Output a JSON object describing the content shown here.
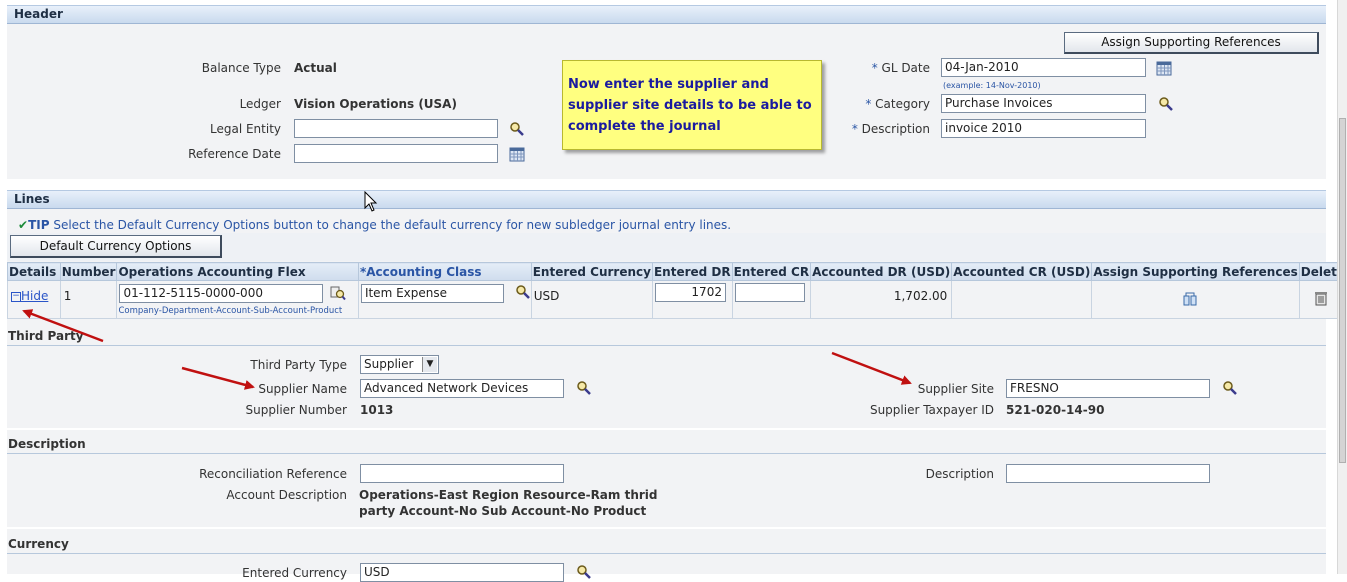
{
  "header": {
    "section_title": "Header",
    "assign_btn": "Assign Supporting References",
    "balance_type_label": "Balance Type",
    "balance_type_value": "Actual",
    "ledger_label": "Ledger",
    "ledger_value": "Vision Operations (USA)",
    "legal_entity_label": "Legal Entity",
    "legal_entity_value": "",
    "reference_date_label": "Reference Date",
    "reference_date_value": "",
    "gl_date_label": "GL Date",
    "gl_date_value": "04-Jan-2010",
    "gl_date_hint": "(example: 14-Nov-2010)",
    "category_label": "Category",
    "category_value": "Purchase Invoices",
    "description_label": "Description",
    "description_value": "invoice 2010",
    "required_mark": "*"
  },
  "callout": {
    "text": "Now enter the supplier and supplier site details to be able to complete the journal"
  },
  "lines": {
    "section_title": "Lines",
    "tip_label": "TIP",
    "tip_text": "Select the Default Currency Options button to change the default currency for new subledger journal entry lines.",
    "default_currency_btn": "Default Currency Options",
    "columns": [
      "Details",
      "Number",
      "Operations Accounting Flex",
      "*Accounting Class",
      "Entered Currency",
      "Entered DR",
      "Entered CR",
      "Accounted DR (USD)",
      "Accounted CR (USD)",
      "Assign Supporting References",
      "Delete"
    ],
    "row": {
      "details_link": "Hide",
      "number": "1",
      "accounting_flex": "01-112-5115-0000-000",
      "flex_hint": "Company-Department-Account-Sub-Account-Product",
      "accounting_class": "Item Expense",
      "entered_currency": "USD",
      "entered_dr": "1702",
      "entered_cr": "",
      "accounted_dr": "1,702.00",
      "accounted_cr": ""
    }
  },
  "third_party": {
    "title": "Third Party",
    "type_label": "Third Party Type",
    "type_value": "Supplier",
    "supplier_name_label": "Supplier Name",
    "supplier_name_value": "Advanced Network Devices",
    "supplier_number_label": "Supplier Number",
    "supplier_number_value": "1013",
    "supplier_site_label": "Supplier Site",
    "supplier_site_value": "FRESNO",
    "taxpayer_label": "Supplier Taxpayer ID",
    "taxpayer_value": "521-020-14-90"
  },
  "description_section": {
    "title": "Description",
    "recon_label": "Reconciliation Reference",
    "recon_value": "",
    "account_desc_label": "Account Description",
    "account_desc_line1": "Operations-East Region Resource-Ram thrid",
    "account_desc_line2": "party Account-No Sub Account-No Product",
    "description_label": "Description",
    "description_value": ""
  },
  "currency_section": {
    "title": "Currency",
    "entered_currency_label": "Entered Currency",
    "entered_currency_value": "USD"
  },
  "colors": {
    "section_bar": "#c9daee",
    "link": "#2a55c8",
    "callout_bg": "#ffff80",
    "callout_text": "#1a1aa0",
    "arrow": "#c01010"
  }
}
